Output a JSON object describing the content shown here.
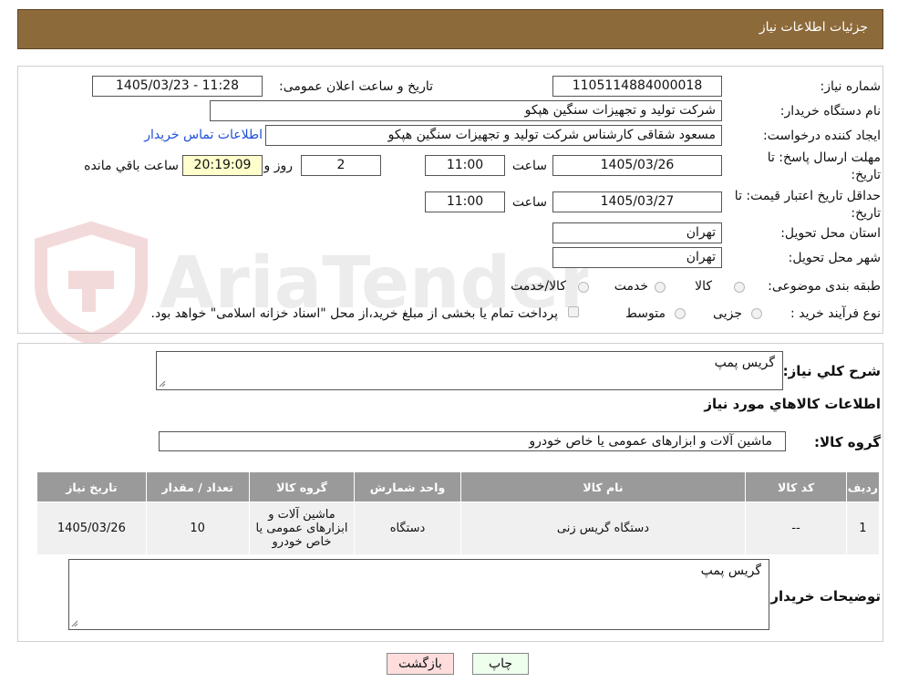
{
  "header": {
    "title": "جزئیات اطلاعات نیاز"
  },
  "form": {
    "need_number_label": "شماره نیاز:",
    "need_number": "1105114884000018",
    "announce_label": "تاریخ و ساعت اعلان عمومی:",
    "announce_value": "1405/03/23 - 11:28",
    "buyer_org_label": "نام دستگاه خریدار:",
    "buyer_org": "شرکت تولید و تجهیزات سنگین هپکو",
    "requester_label": "ایجاد کننده درخواست:",
    "requester": "مسعود شقاقی کارشناس شرکت تولید و تجهیزات سنگین هپکو",
    "contact_link": "اطلاعات تماس خریدار",
    "reply_deadline_label": "مهلت ارسال پاسخ: تا تاریخ:",
    "reply_date": "1405/03/26",
    "time_label": "ساعت",
    "reply_time": "11:00",
    "days": "2",
    "days_label": "روز و",
    "remaining_time": "20:19:09",
    "remaining_label": "ساعت باقي مانده",
    "price_validity_label": "حداقل تاریخ اعتبار قیمت: تا تاریخ:",
    "price_date": "1405/03/27",
    "price_time": "11:00",
    "province_label": "استان محل تحویل:",
    "province": "تهران",
    "city_label": "شهر محل تحویل:",
    "city": "تهران",
    "category_label": "طبقه بندی موضوعی:",
    "category_options": [
      "کالا",
      "خدمت",
      "کالا/خدمت"
    ],
    "process_label": "نوع فرآیند خرید :",
    "process_options": [
      "جزیی",
      "متوسط"
    ],
    "payment_note": "پرداخت تمام یا بخشی از مبلغ خرید،از محل \"اسناد خزانه اسلامی\" خواهد بود."
  },
  "details": {
    "general_desc_label": "شرح كلي نياز:",
    "general_desc": "گریس پمپ",
    "goods_info_title": "اطلاعات کالاهاي مورد نياز",
    "goods_group_label": "گروه کالا:",
    "goods_group": "ماشین آلات و ابزارهای عمومی یا خاص خودرو",
    "table": {
      "headers": [
        "ردیف",
        "کد کالا",
        "نام کالا",
        "واحد شمارش",
        "گروه کالا",
        "تعداد / مقدار",
        "تاریخ نیاز"
      ],
      "rows": [
        [
          "1",
          "--",
          "دستگاه گریس زنی",
          "دستگاه",
          "ماشین آلات و ابزارهای عمومی یا خاص خودرو",
          "10",
          "1405/03/26"
        ]
      ]
    },
    "buyer_notes_label": "توضیحات خریدار:",
    "buyer_notes": "گریس پمپ"
  },
  "buttons": {
    "print": "چاپ",
    "back": "بازگشت"
  },
  "colors": {
    "header_bg": "#8c6a3a",
    "table_header_bg": "#9a9a9a",
    "back_button_bg": "#ffdddd",
    "print_button_bg": "#eeffee",
    "link": "#1e4fd8"
  },
  "watermark": "AriaTender.neT"
}
